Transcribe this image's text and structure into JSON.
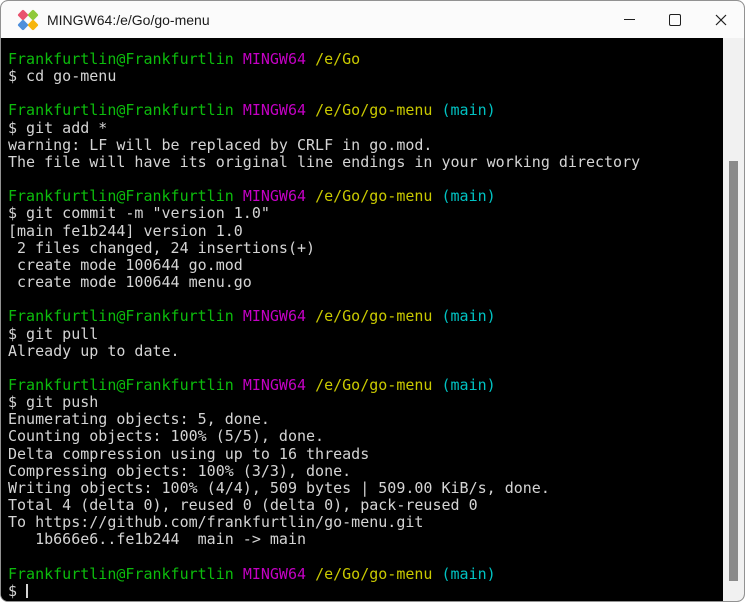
{
  "window": {
    "title": "MINGW64:/e/Go/go-menu"
  },
  "colors": {
    "terminal_bg": "#000000",
    "fg": "#d4d4d4",
    "green": "#0cbc0c",
    "magenta": "#c400c4",
    "yellow": "#c9c900",
    "cyan": "#00c2c2",
    "titlebar_bg": "#fbfbfb",
    "title_fg": "#1b1b1b",
    "scroll_track": "#f1f1f1",
    "scroll_thumb": "#8b8b8b",
    "icon_red": "#e9536e",
    "icon_green": "#8fc93a",
    "icon_blue": "#4d8fdb",
    "icon_yellow": "#f7b50c"
  },
  "terminal": {
    "lines": [
      [
        {
          "c": "green",
          "t": "Frankfurtlin@Frankfurtlin"
        },
        {
          "t": " "
        },
        {
          "c": "magenta",
          "t": "MINGW64"
        },
        {
          "t": " "
        },
        {
          "c": "yellow",
          "t": "/e/Go"
        }
      ],
      [
        {
          "t": "$ cd go-menu"
        }
      ],
      [],
      [
        {
          "c": "green",
          "t": "Frankfurtlin@Frankfurtlin"
        },
        {
          "t": " "
        },
        {
          "c": "magenta",
          "t": "MINGW64"
        },
        {
          "t": " "
        },
        {
          "c": "yellow",
          "t": "/e/Go/go-menu"
        },
        {
          "t": " "
        },
        {
          "c": "cyan",
          "t": "(main)"
        }
      ],
      [
        {
          "t": "$ git add *"
        }
      ],
      [
        {
          "t": "warning: LF will be replaced by CRLF in go.mod."
        }
      ],
      [
        {
          "t": "The file will have its original line endings in your working directory"
        }
      ],
      [],
      [
        {
          "c": "green",
          "t": "Frankfurtlin@Frankfurtlin"
        },
        {
          "t": " "
        },
        {
          "c": "magenta",
          "t": "MINGW64"
        },
        {
          "t": " "
        },
        {
          "c": "yellow",
          "t": "/e/Go/go-menu"
        },
        {
          "t": " "
        },
        {
          "c": "cyan",
          "t": "(main)"
        }
      ],
      [
        {
          "t": "$ git commit -m \"version 1.0\""
        }
      ],
      [
        {
          "t": "[main fe1b244] version 1.0"
        }
      ],
      [
        {
          "t": " 2 files changed, 24 insertions(+)"
        }
      ],
      [
        {
          "t": " create mode 100644 go.mod"
        }
      ],
      [
        {
          "t": " create mode 100644 menu.go"
        }
      ],
      [],
      [
        {
          "c": "green",
          "t": "Frankfurtlin@Frankfurtlin"
        },
        {
          "t": " "
        },
        {
          "c": "magenta",
          "t": "MINGW64"
        },
        {
          "t": " "
        },
        {
          "c": "yellow",
          "t": "/e/Go/go-menu"
        },
        {
          "t": " "
        },
        {
          "c": "cyan",
          "t": "(main)"
        }
      ],
      [
        {
          "t": "$ git pull"
        }
      ],
      [
        {
          "t": "Already up to date."
        }
      ],
      [],
      [
        {
          "c": "green",
          "t": "Frankfurtlin@Frankfurtlin"
        },
        {
          "t": " "
        },
        {
          "c": "magenta",
          "t": "MINGW64"
        },
        {
          "t": " "
        },
        {
          "c": "yellow",
          "t": "/e/Go/go-menu"
        },
        {
          "t": " "
        },
        {
          "c": "cyan",
          "t": "(main)"
        }
      ],
      [
        {
          "t": "$ git push"
        }
      ],
      [
        {
          "t": "Enumerating objects: 5, done."
        }
      ],
      [
        {
          "t": "Counting objects: 100% (5/5), done."
        }
      ],
      [
        {
          "t": "Delta compression using up to 16 threads"
        }
      ],
      [
        {
          "t": "Compressing objects: 100% (3/3), done."
        }
      ],
      [
        {
          "t": "Writing objects: 100% (4/4), 509 bytes | 509.00 KiB/s, done."
        }
      ],
      [
        {
          "t": "Total 4 (delta 0), reused 0 (delta 0), pack-reused 0"
        }
      ],
      [
        {
          "t": "To https://github.com/frankfurtlin/go-menu.git"
        }
      ],
      [
        {
          "t": "   1b666e6..fe1b244  main -> main"
        }
      ],
      [],
      [
        {
          "c": "green",
          "t": "Frankfurtlin@Frankfurtlin"
        },
        {
          "t": " "
        },
        {
          "c": "magenta",
          "t": "MINGW64"
        },
        {
          "t": " "
        },
        {
          "c": "yellow",
          "t": "/e/Go/go-menu"
        },
        {
          "t": " "
        },
        {
          "c": "cyan",
          "t": "(main)"
        }
      ],
      [
        {
          "t": "$ "
        },
        {
          "cursor": true
        }
      ]
    ]
  }
}
